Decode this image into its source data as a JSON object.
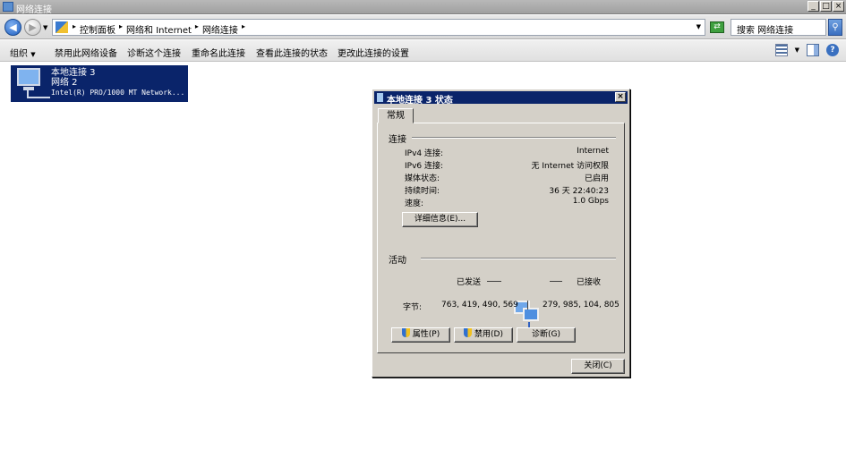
{
  "window": {
    "title": "网络连接",
    "min": "_",
    "max": "□",
    "close": "×"
  },
  "address": {
    "crumbs": [
      "控制面板",
      "网络和 Internet",
      "网络连接"
    ],
    "search_placeholder": "搜索 网络连接"
  },
  "toolbar": {
    "items": [
      "组织",
      "禁用此网络设备",
      "诊断这个连接",
      "重命名此连接",
      "查看此连接的状态",
      "更改此连接的设置"
    ]
  },
  "connection": {
    "name": "本地连接 3",
    "network": "网络  2",
    "device": "Intel(R) PRO/1000 MT Network..."
  },
  "dialog": {
    "title": "本地连接 3 状态",
    "tab": "常规",
    "connection_group": "连接",
    "rows": [
      {
        "label": "IPv4 连接:",
        "value": "Internet"
      },
      {
        "label": "IPv6 连接:",
        "value": "无 Internet 访问权限"
      },
      {
        "label": "媒体状态:",
        "value": "已启用"
      },
      {
        "label": "持续时间:",
        "value": "36 天 22:40:23"
      },
      {
        "label": "速度:",
        "value": "1.0 Gbps"
      }
    ],
    "details_button": "详细信息(E)...",
    "activity_group": "活动",
    "sent_label": "已发送",
    "received_label": "已接收",
    "bytes_label": "字节:",
    "bytes_sent": "763, 419, 490, 569",
    "bytes_received": "279, 985, 104, 805",
    "properties_button": "属性(P)",
    "disable_button": "禁用(D)",
    "diagnose_button": "诊断(G)",
    "close_button": "关闭(C)"
  }
}
